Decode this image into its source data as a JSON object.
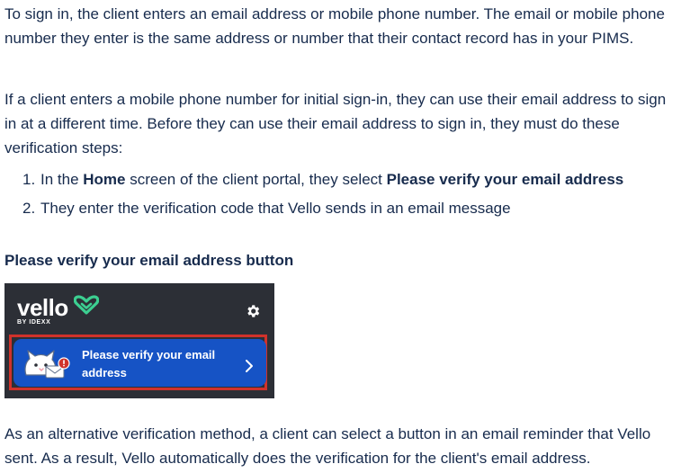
{
  "paragraphs": {
    "p1": "To sign in, the client enters an email address or mobile phone number. The email or mobile phone number they enter is the same address or number that their contact record has in your PIMS.",
    "p2": "If a client enters a mobile phone number for initial sign-in, they can use their email address to sign in at a different time. Before they can use their email address to sign in, they must do these verification steps:",
    "p3": "As an alternative verification method, a client can select a button in an email reminder that Vello sent. As a result, Vello automatically does the verification for the client's email address."
  },
  "steps": [
    {
      "number": "1.",
      "before": "In the ",
      "strong1": "Home",
      "middle": " screen of the client portal, they select ",
      "strong2": "Please verify your email address"
    },
    {
      "number": "2.",
      "text": "They enter the verification code that Vello sends in an email message"
    }
  ],
  "section_heading": "Please verify your email address button",
  "figure": {
    "logo_text": "vello",
    "logo_subtext": "BY IDEXX",
    "gear_icon": "gear-icon",
    "verify_button_label": "Please verify your email address",
    "cat_icon": "cat-envelope-icon",
    "chevron_icon": "chevron-right-icon",
    "colors": {
      "banner_bg": "#2c2f36",
      "button_bg": "#1653c5",
      "highlight_border": "#d0322b",
      "heart_green": "#3ccf91",
      "alert_red": "#d0322b"
    }
  }
}
